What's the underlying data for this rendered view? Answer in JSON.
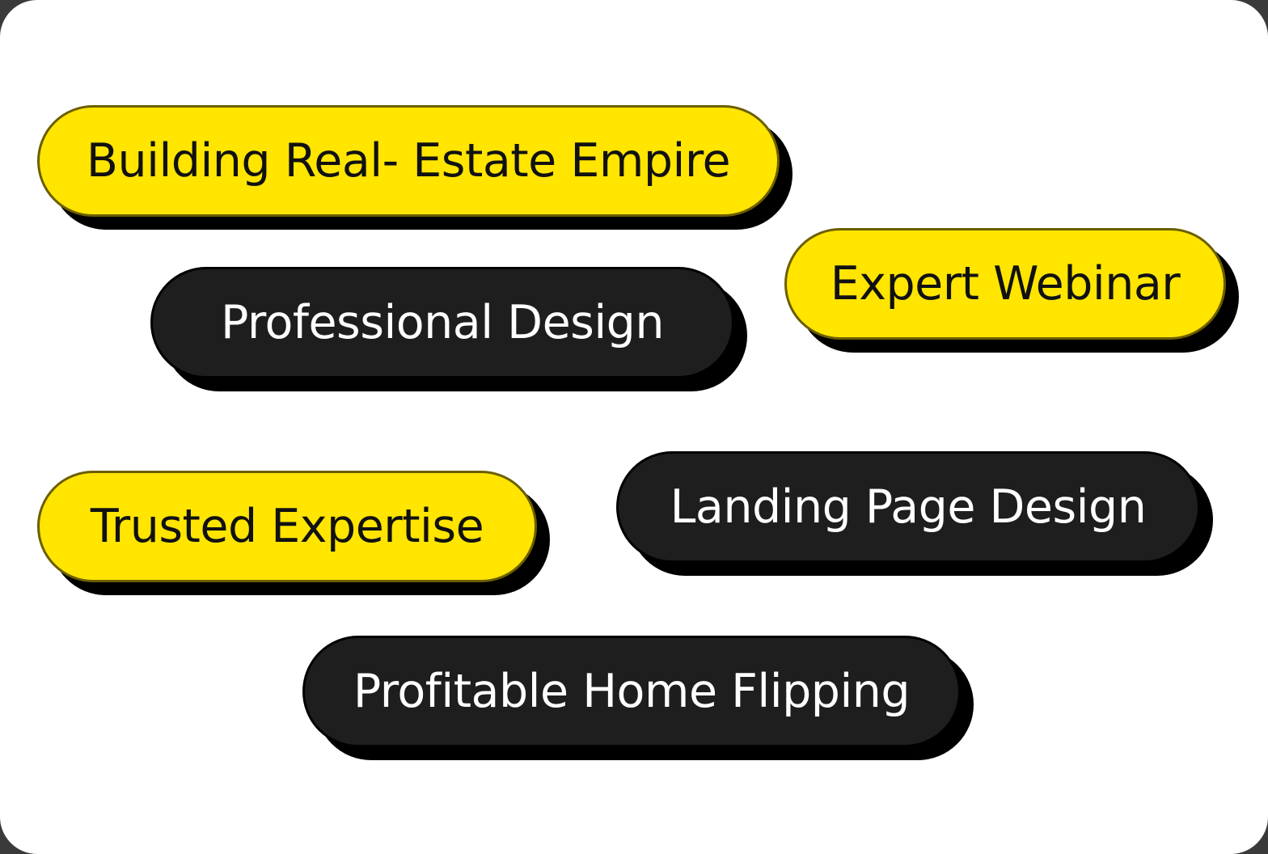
{
  "colors": {
    "yellow_tag": "#ffe500",
    "dark_tag": "#1e1e1e",
    "shadow": "#000000",
    "card": "#ffffff"
  },
  "tags": [
    {
      "label": "Building Real- Estate Empire",
      "style": "yellow"
    },
    {
      "label": "Expert Webinar",
      "style": "yellow"
    },
    {
      "label": "Professional Design",
      "style": "dark"
    },
    {
      "label": "Trusted Expertise",
      "style": "yellow"
    },
    {
      "label": "Landing Page Design",
      "style": "dark"
    },
    {
      "label": "Profitable Home Flipping",
      "style": "dark"
    }
  ]
}
